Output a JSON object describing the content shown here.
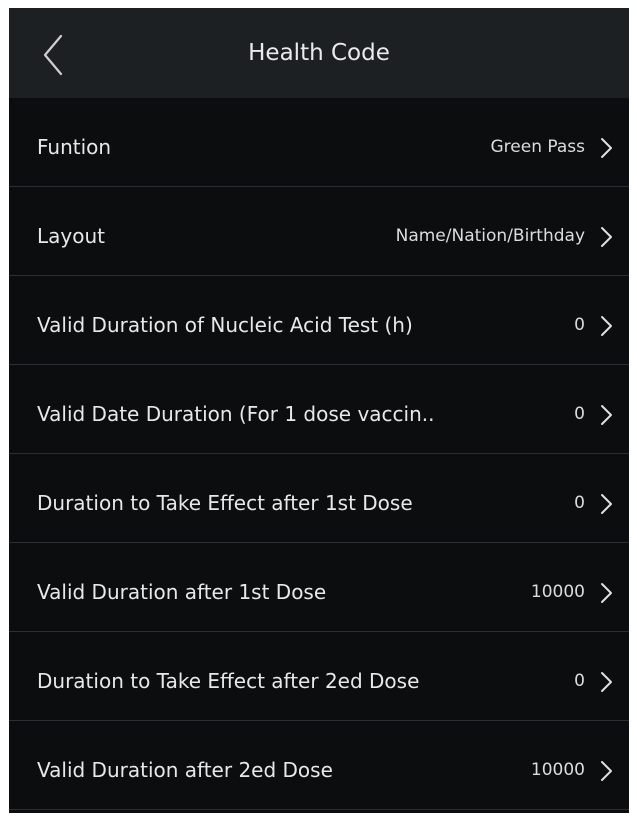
{
  "header": {
    "title": "Health Code",
    "back_icon": "chevron-left-icon"
  },
  "settings": [
    {
      "label": "Funtion",
      "value": "Green Pass"
    },
    {
      "label": "Layout",
      "value": "Name/Nation/Birthday"
    },
    {
      "label": "Valid Duration of Nucleic Acid Test (h)",
      "value": "0"
    },
    {
      "label": "Valid Date Duration (For 1 dose vaccin..",
      "value": "0"
    },
    {
      "label": "Duration to Take Effect after 1st Dose",
      "value": "0"
    },
    {
      "label": "Valid Duration after 1st Dose",
      "value": "10000"
    },
    {
      "label": "Duration to Take Effect after 2ed Dose",
      "value": "0"
    },
    {
      "label": "Valid Duration after 2ed Dose",
      "value": "10000"
    }
  ],
  "row_icon": "chevron-right-icon",
  "colors": {
    "background": "#0b0d0f",
    "header": "#1d2023",
    "text": "#e8e8e8",
    "divider": "#2c2f32"
  }
}
